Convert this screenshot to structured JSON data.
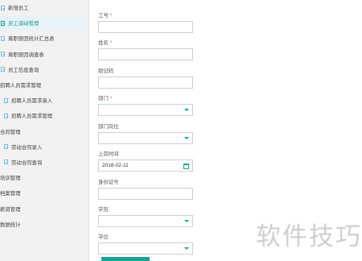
{
  "sidebar": {
    "items": [
      {
        "label": "新增员工",
        "level": "child",
        "icon": "document-icon",
        "active": false
      },
      {
        "label": "员工调动管理",
        "level": "child",
        "icon": "document-icon",
        "active": true
      },
      {
        "label": "离职原因统计汇总表",
        "level": "child",
        "icon": "document-icon",
        "active": false
      },
      {
        "label": "离职原因调查表",
        "level": "child",
        "icon": "document-icon",
        "active": false
      },
      {
        "label": "员工信息查询",
        "level": "child",
        "icon": "document-icon",
        "active": false
      },
      {
        "label": "招聘人员需求管理",
        "level": "top",
        "icon": "",
        "active": false
      },
      {
        "label": "招聘人员需求录入",
        "level": "sub",
        "icon": "document-icon",
        "active": false
      },
      {
        "label": "招聘人员需求管理",
        "level": "sub",
        "icon": "document-icon",
        "active": false
      },
      {
        "label": "合同管理",
        "level": "top",
        "icon": "",
        "active": false
      },
      {
        "label": "劳动合同录入",
        "level": "sub",
        "icon": "document-icon",
        "active": false
      },
      {
        "label": "劳动合同查询",
        "level": "sub",
        "icon": "document-icon",
        "active": false
      },
      {
        "label": "培训管理",
        "level": "top",
        "icon": "",
        "active": false
      },
      {
        "label": "档案管理",
        "level": "top",
        "icon": "",
        "active": false
      },
      {
        "label": "薪资管理",
        "level": "top",
        "icon": "",
        "active": false
      },
      {
        "label": "数据统计",
        "level": "top",
        "icon": "",
        "active": false
      }
    ]
  },
  "form": {
    "fields": [
      {
        "label": "工号",
        "required": true,
        "type": "text",
        "value": ""
      },
      {
        "label": "姓名",
        "required": true,
        "type": "text",
        "value": ""
      },
      {
        "label": "助记码",
        "required": false,
        "type": "text",
        "value": ""
      },
      {
        "label": "部门",
        "required": true,
        "type": "select",
        "value": ""
      },
      {
        "label": "部门岗位",
        "required": false,
        "type": "select",
        "value": ""
      },
      {
        "label": "上岗时间",
        "required": false,
        "type": "date",
        "value": "2018-02-11"
      },
      {
        "label": "身份证号",
        "required": false,
        "type": "text",
        "value": ""
      },
      {
        "label": "学历",
        "required": false,
        "type": "select",
        "value": ""
      },
      {
        "label": "学位",
        "required": false,
        "type": "select",
        "value": ""
      }
    ],
    "required_mark": "*"
  },
  "watermark": "软件技巧",
  "colors": {
    "accent": "#19a394",
    "required": "#e5534b",
    "sidebar_bg": "#f2f2f2",
    "active_bg": "#e8f1f5"
  }
}
